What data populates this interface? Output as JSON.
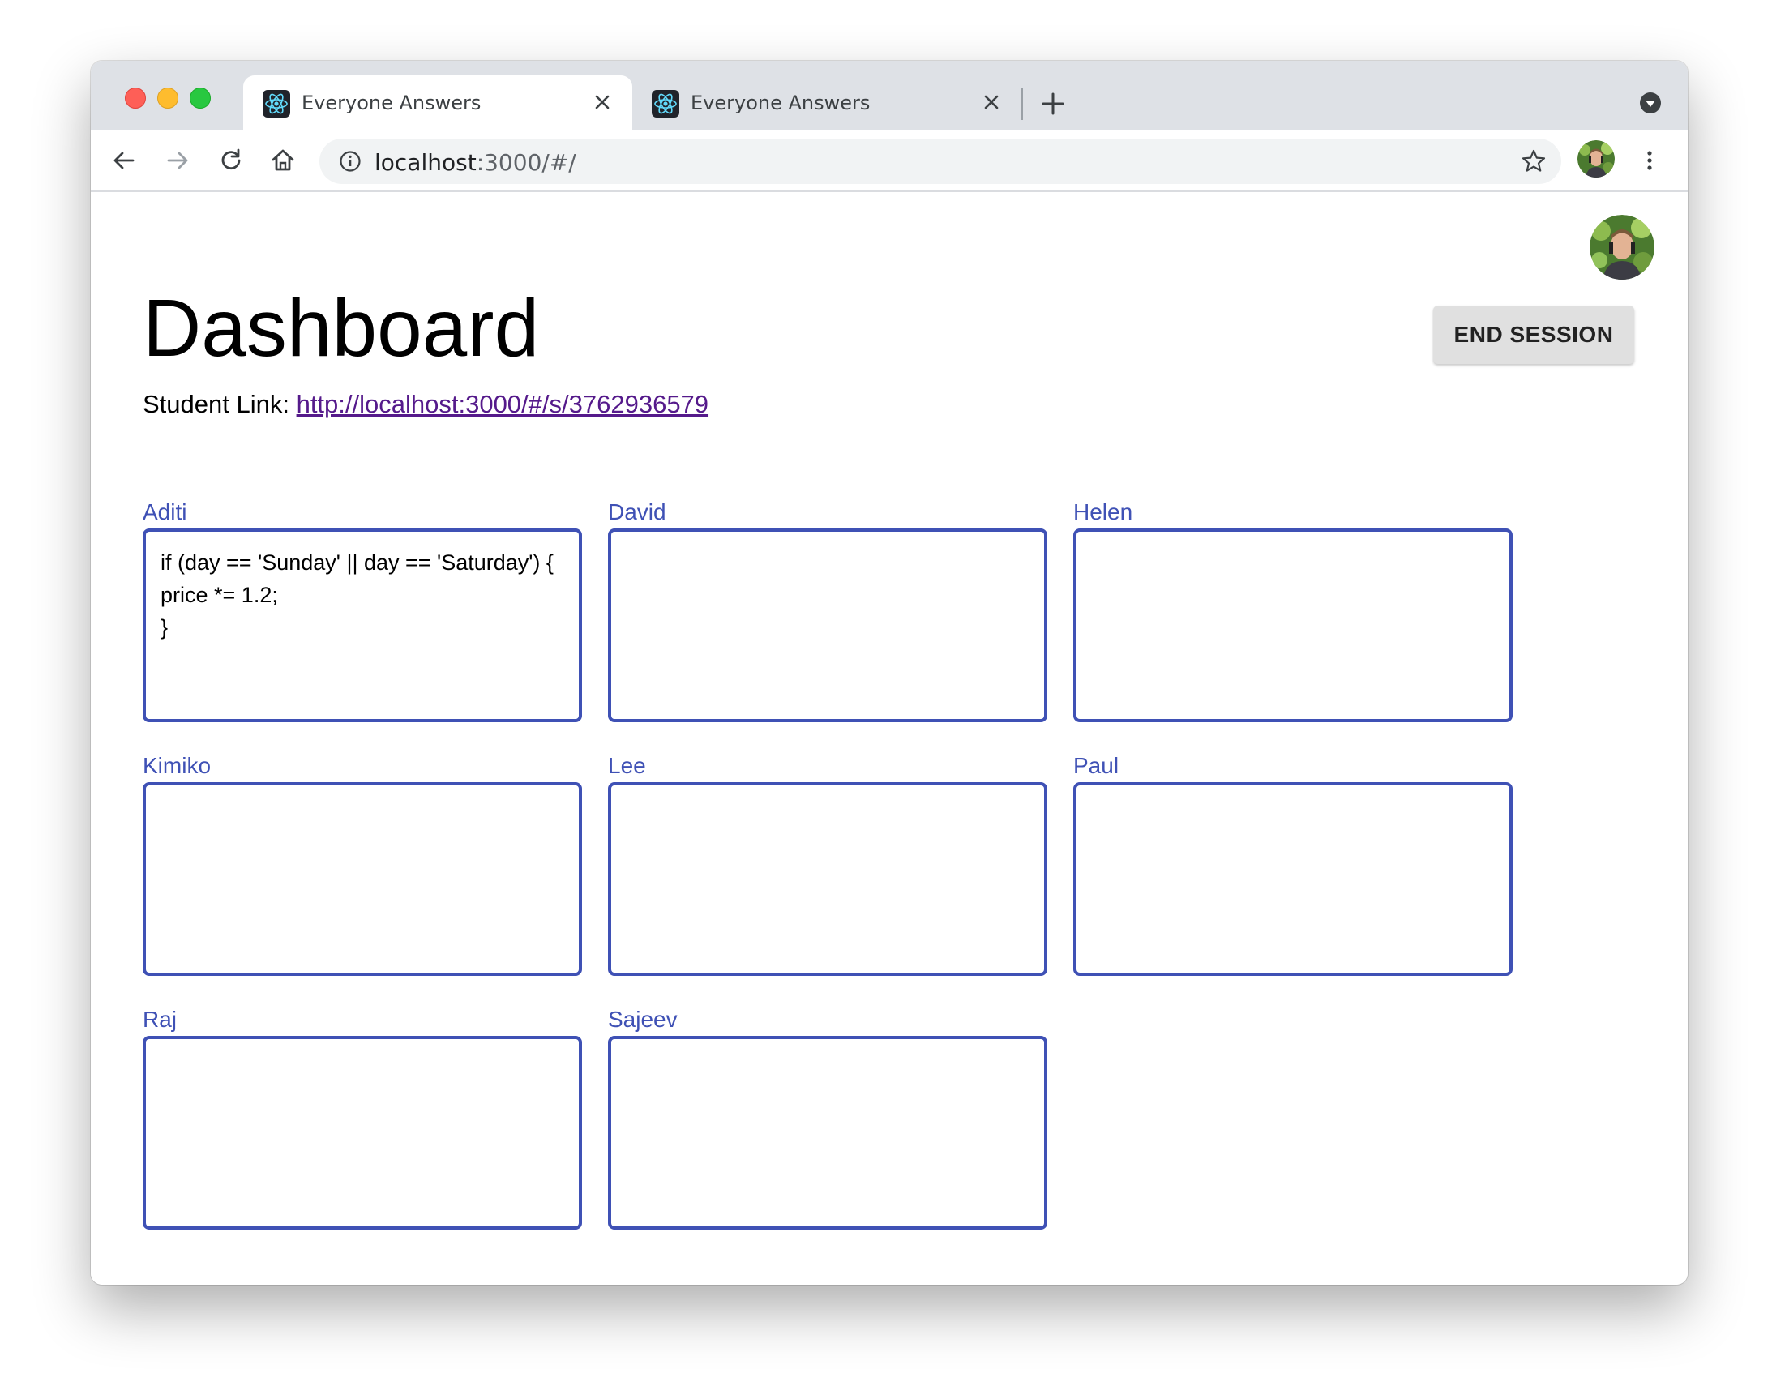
{
  "browser": {
    "tabs": [
      {
        "title": "Everyone Answers",
        "active": true
      },
      {
        "title": "Everyone Answers",
        "active": false
      }
    ],
    "address_host": "localhost",
    "address_rest": ":3000/#/"
  },
  "page": {
    "title": "Dashboard",
    "end_button_label": "END SESSION",
    "student_link_label": "Student Link: ",
    "student_link_url": "http://localhost:3000/#/s/3762936579",
    "students": [
      {
        "name": "Aditi",
        "answer": "if (day == 'Sunday' || day == 'Saturday') {\nprice *= 1.2;\n}"
      },
      {
        "name": "David",
        "answer": ""
      },
      {
        "name": "Helen",
        "answer": ""
      },
      {
        "name": "Kimiko",
        "answer": ""
      },
      {
        "name": "Lee",
        "answer": ""
      },
      {
        "name": "Paul",
        "answer": ""
      },
      {
        "name": "Raj",
        "answer": ""
      },
      {
        "name": "Sajeev",
        "answer": ""
      }
    ]
  },
  "colors": {
    "accent": "#3f51b5",
    "link_visited": "#551a8b",
    "button_bg": "#e0e0e0",
    "tabstrip_bg": "#dee1e6"
  },
  "icons": [
    "react-favicon-icon",
    "close-icon",
    "new-tab-icon",
    "tab-search-icon",
    "back-icon",
    "forward-icon",
    "reload-icon",
    "home-icon",
    "info-icon",
    "star-icon",
    "kebab-menu-icon",
    "avatar"
  ]
}
